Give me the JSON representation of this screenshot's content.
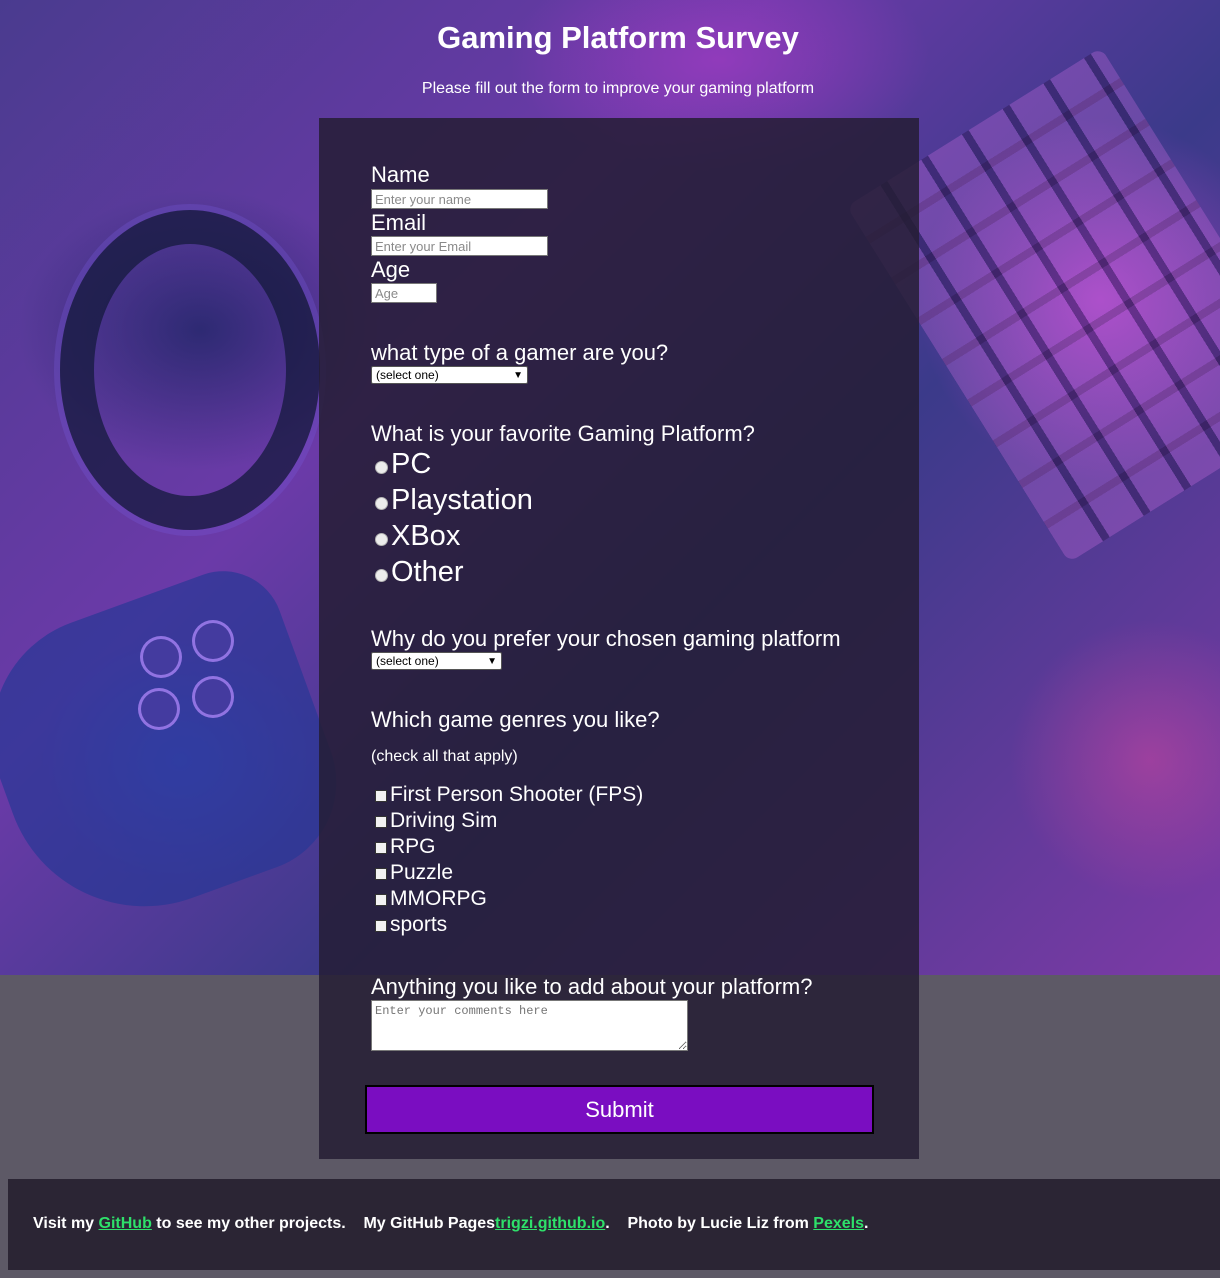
{
  "header": {
    "title": "Gaming Platform Survey",
    "description": "Please fill out the form to improve your gaming platform"
  },
  "form": {
    "name": {
      "label": "Name",
      "placeholder": "Enter your name"
    },
    "email": {
      "label": "Email",
      "placeholder": "Enter your Email"
    },
    "age": {
      "label": "Age",
      "placeholder": "Age"
    },
    "gamer_type": {
      "label": "what type of a gamer are you?",
      "selected": "(select one)"
    },
    "platform": {
      "label": "What is your favorite Gaming Platform?",
      "options": [
        "PC",
        "Playstation",
        "XBox",
        "Other"
      ]
    },
    "reason": {
      "label": "Why do you prefer your chosen gaming platform",
      "selected": "(select one)"
    },
    "genres": {
      "label": "Which game genres you like?",
      "hint": "(check all that apply)",
      "options": [
        "First Person Shooter (FPS)",
        "Driving Sim",
        "RPG",
        "Puzzle",
        "MMORPG",
        "sports"
      ]
    },
    "comments": {
      "label": "Anything you like to add about your platform?",
      "placeholder": "Enter your comments here"
    },
    "submit_label": "Submit"
  },
  "footer": {
    "visit_prefix": "Visit my ",
    "github_link": "GitHub",
    "visit_suffix": " to see my other projects.",
    "pages_prefix": "My GitHub Pages",
    "pages_link": "trigzi.github.io",
    "pages_suffix": ".",
    "photo_prefix": "Photo by Lucie Liz from ",
    "pexels_link": "Pexels",
    "photo_suffix": ".",
    "link_color": "#2ee06a"
  },
  "colors": {
    "panel": "#251d34",
    "submit": "#7a0dc1",
    "footer": "#2b2534"
  }
}
